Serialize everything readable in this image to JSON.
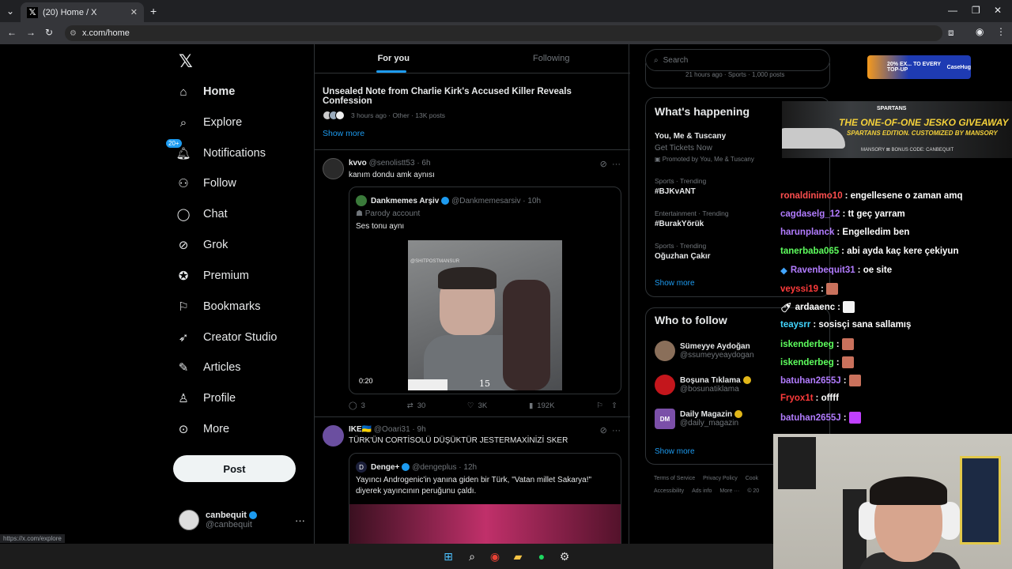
{
  "browser": {
    "tab_title": "(20) Home / X",
    "new_tab": "+",
    "url": "x.com/home",
    "status_url": "https://x.com/explore"
  },
  "nav": {
    "logo": "X",
    "items": [
      {
        "label": "Home",
        "icon": "home-icon"
      },
      {
        "label": "Explore",
        "icon": "search-icon"
      },
      {
        "label": "Notifications",
        "icon": "bell-icon",
        "badge": "20+"
      },
      {
        "label": "Follow",
        "icon": "add-person-icon"
      },
      {
        "label": "Chat",
        "icon": "chat-icon"
      },
      {
        "label": "Grok",
        "icon": "grok-icon"
      },
      {
        "label": "Premium",
        "icon": "verified-icon"
      },
      {
        "label": "Bookmarks",
        "icon": "bookmark-icon"
      },
      {
        "label": "Creator Studio",
        "icon": "rocket-icon"
      },
      {
        "label": "Articles",
        "icon": "article-icon"
      },
      {
        "label": "Profile",
        "icon": "person-icon"
      },
      {
        "label": "More",
        "icon": "more-circle-icon"
      }
    ],
    "post_label": "Post",
    "account": {
      "name": "canbequit",
      "handle": "@canbequit",
      "more": "···"
    }
  },
  "feed": {
    "tabs": [
      "For you",
      "Following"
    ],
    "news": {
      "headline": "Unsealed Note from Charlie Kirk's Accused Killer Reveals Confession",
      "meta": "3 hours ago · Other · 13K posts",
      "show_more": "Show more"
    },
    "tweet1": {
      "name": "kvvo",
      "handle": "@senolistt53 · 6h",
      "text": "kanım dondu amk aynısı",
      "quote": {
        "name": "Dankmemes Arşiv",
        "handle": "@Dankmemesarsiv · 10h",
        "label": "Parody account",
        "text": "Ses tonu aynı",
        "watermark": "@SHITPOSTMANSUR",
        "video_time": "0:20",
        "video_number": "15"
      },
      "actions": {
        "replies": "3",
        "reposts": "30",
        "likes": "3K",
        "views": "192K"
      }
    },
    "tweet2": {
      "name": "IKE🇺🇦",
      "handle": "@Ooari31 · 9h",
      "text": "TÜRK'ÜN CORTİSOLÜ DÜŞÜKTÜR JESTERMAXİNİZİ SKER",
      "quote": {
        "name": "Denge+",
        "handle": "@dengeplus · 12h",
        "text": "Yayıncı Androgenic'in yanına giden bir Türk, \"Vatan millet Sakarya!\" diyerek yayıncının peruğunu çaldı."
      }
    }
  },
  "sidebar": {
    "search_placeholder": "Search",
    "prev_meta": "21 hours ago · Sports · 1,000 posts",
    "happening": {
      "title": "What's happening",
      "promo": {
        "title": "You, Me & Tuscany",
        "sub": "Get Tickets Now",
        "by": "Promoted by You, Me & Tuscany"
      },
      "trends": [
        {
          "context": "Sports · Trending",
          "name": "#BJKvANT"
        },
        {
          "context": "Entertainment · Trending",
          "name": "#BurakYörük"
        },
        {
          "context": "Sports · Trending",
          "name": "Oğuzhan Çakır"
        }
      ],
      "show_more": "Show more"
    },
    "follow": {
      "title": "Who to follow",
      "people": [
        {
          "name": "Sümeyye Aydoğan",
          "handle": "@ssumeyyeaydogan"
        },
        {
          "name": "Boşuna Tıklama",
          "handle": "@bosunatiklama"
        },
        {
          "name": "Daily Magazin",
          "handle": "@daily_magazin",
          "avatar_text": "DM"
        }
      ],
      "show_more": "Show more"
    },
    "footer": [
      "Terms of Service",
      "Privacy Policy",
      "Cook",
      "Accessibility",
      "Ads info",
      "More ···",
      "© 20"
    ]
  },
  "overlays": {
    "ad_text": "20% EX... TO EVERY TOP-UP",
    "ad_brand": "CaseHug",
    "spartans": {
      "brand": "SPARTANS",
      "headline": "THE ONE-OF-ONE JESKO GIVEAWAY",
      "sub": "SPARTANS EDITION. CUSTOMIZED BY MANSORY",
      "foot": "MANSORY   ⊠   BONUS CODE: CANBEQUIT"
    },
    "chat": [
      {
        "user": "ronaldinimo10",
        "color": "#ff4f4f",
        "text": ": engellesene o zaman amq"
      },
      {
        "user": "cagdaselg_12",
        "color": "#b27cff",
        "text": ": tt geç yarram"
      },
      {
        "user": "harunplanck",
        "color": "#b27cff",
        "text": ": Engelledim ben"
      },
      {
        "user": "tanerbaba065",
        "color": "#5eff5e",
        "text": ": abi ayda kaç kere çekiyun"
      },
      {
        "user": "Ravenbequit31",
        "color": "#b27cff",
        "text": ": oe site"
      },
      {
        "user": "veyssi19",
        "color": "#ff3b3b",
        "text": ":"
      },
      {
        "user": "ardaaenc",
        "color": "#ffffff",
        "text": ":"
      },
      {
        "user": "teaysrr",
        "color": "#42d6ff",
        "text": ": sosisçi sana sallamış"
      },
      {
        "user": "iskenderbeg",
        "color": "#5eff5e",
        "text": ":"
      },
      {
        "user": "iskenderbeg",
        "color": "#5eff5e",
        "text": ":"
      },
      {
        "user": "batuhan2655J",
        "color": "#b27cff",
        "text": ":"
      },
      {
        "user": "Fryox1t",
        "color": "#ff3b3b",
        "text": ": offff"
      },
      {
        "user": "batuhan2655J",
        "color": "#b27cff",
        "text": ":"
      }
    ]
  },
  "colors": {
    "accent": "#1d9bf0",
    "background": "#000000",
    "border": "#2f3336"
  }
}
